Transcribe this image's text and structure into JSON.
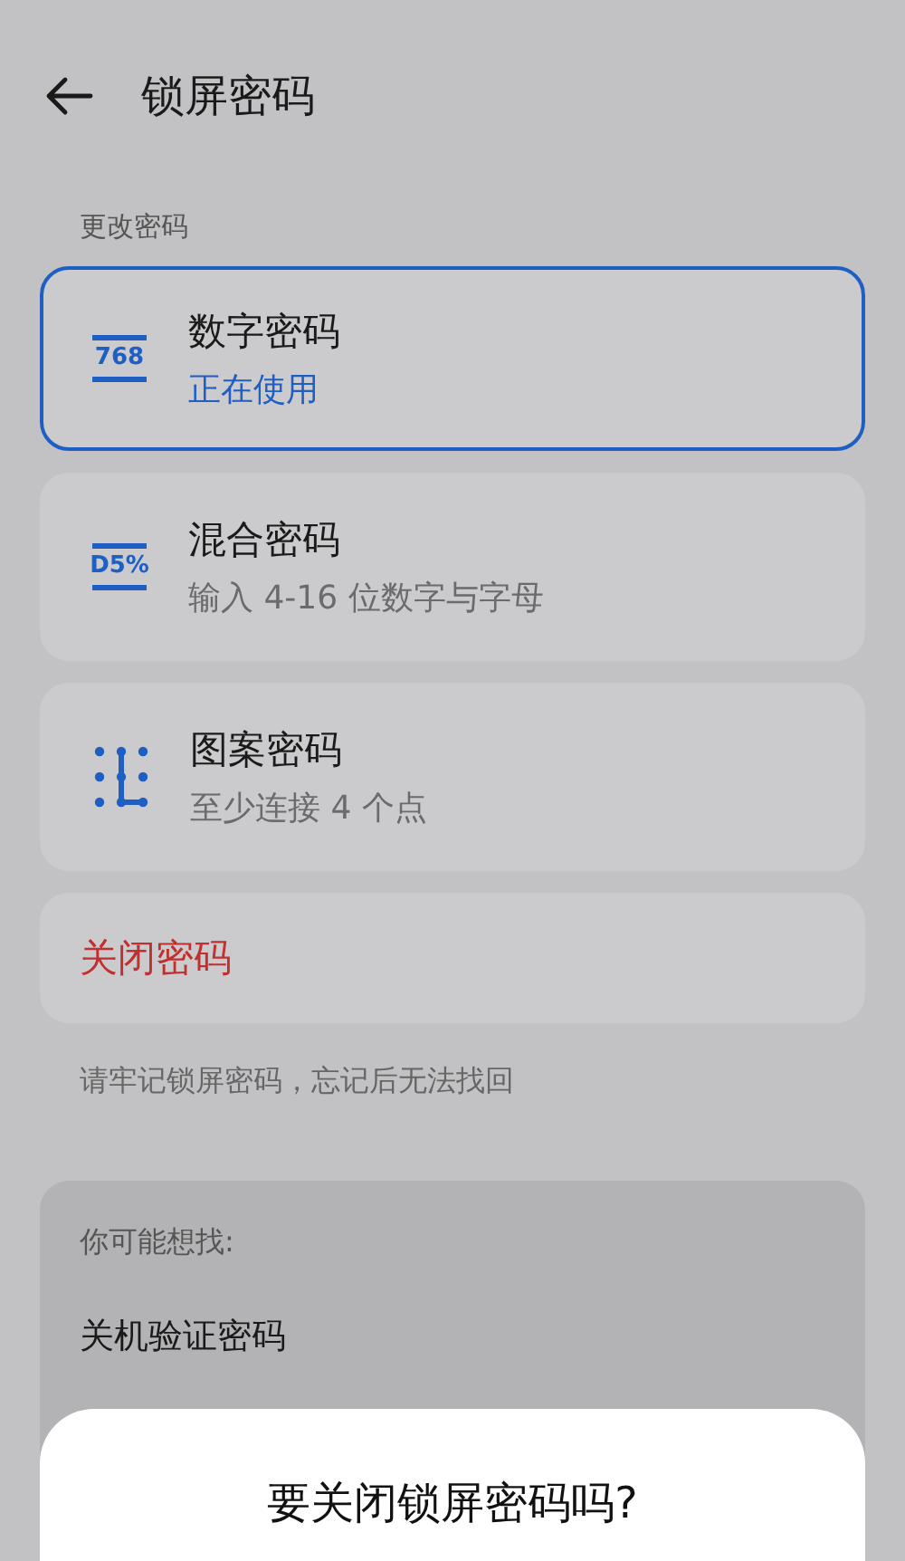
{
  "header": {
    "title": "锁屏密码"
  },
  "section_label": "更改密码",
  "options": [
    {
      "kind": "digits",
      "icon_text": "768",
      "title": "数字密码",
      "subtitle": "正在使用",
      "selected": true
    },
    {
      "kind": "mixed",
      "icon_text": "D5%",
      "title": "混合密码",
      "subtitle": "输入 4-16 位数字与字母",
      "selected": false
    },
    {
      "kind": "pattern",
      "title": "图案密码",
      "subtitle": "至少连接 4 个点",
      "selected": false
    }
  ],
  "close_password": "关闭密码",
  "hint": "请牢记锁屏密码，忘记后无法找回",
  "suggestions": {
    "label": "你可能想找:",
    "items": [
      "关机验证密码"
    ]
  },
  "dialog": {
    "title": "要关闭锁屏密码吗?"
  }
}
